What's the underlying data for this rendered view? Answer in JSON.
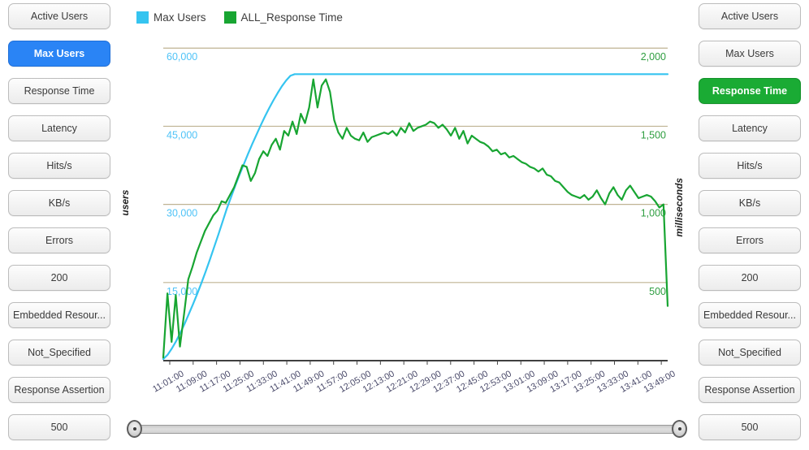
{
  "sidebar_left": {
    "selected": "Max Users",
    "items": [
      {
        "label": "Active Users",
        "state": "normal"
      },
      {
        "label": "Max Users",
        "state": "selected-blue"
      },
      {
        "label": "Response Time",
        "state": "normal"
      },
      {
        "label": "Latency",
        "state": "normal"
      },
      {
        "label": "Hits/s",
        "state": "normal"
      },
      {
        "label": "KB/s",
        "state": "normal"
      },
      {
        "label": "Errors",
        "state": "normal"
      },
      {
        "label": "200",
        "state": "normal"
      },
      {
        "label": "Embedded Resour...",
        "state": "normal"
      },
      {
        "label": "Not_Specified",
        "state": "normal"
      },
      {
        "label": "Response Assertion",
        "state": "normal"
      },
      {
        "label": "500",
        "state": "normal"
      }
    ]
  },
  "sidebar_right": {
    "selected": "Response Time",
    "items": [
      {
        "label": "Active Users",
        "state": "normal"
      },
      {
        "label": "Max Users",
        "state": "normal"
      },
      {
        "label": "Response Time",
        "state": "selected-green"
      },
      {
        "label": "Latency",
        "state": "normal"
      },
      {
        "label": "Hits/s",
        "state": "normal"
      },
      {
        "label": "KB/s",
        "state": "normal"
      },
      {
        "label": "Errors",
        "state": "normal"
      },
      {
        "label": "200",
        "state": "normal"
      },
      {
        "label": "Embedded Resour...",
        "state": "normal"
      },
      {
        "label": "Not_Specified",
        "state": "normal"
      },
      {
        "label": "Response Assertion",
        "state": "normal"
      },
      {
        "label": "500",
        "state": "normal"
      }
    ]
  },
  "slider": {
    "left_handle_position_pct": 0,
    "right_handle_position_pct": 100
  },
  "colors": {
    "max_users": "#35c4f0",
    "response_time": "#18a532",
    "gridline": "#bfb393",
    "axis": "#000000",
    "left_axis_text": "#4fc3f7",
    "right_axis_text": "#2f9e41",
    "xtick_text": "#4a4a6a",
    "selected_blue": "#2a84f5",
    "selected_green": "#1aab34"
  },
  "chart_data": {
    "type": "line",
    "title": "",
    "xlabel": "",
    "legend": [
      {
        "name": "Max Users",
        "color": "#35c4f0",
        "axis": "left"
      },
      {
        "name": "ALL_Response Time",
        "color": "#18a532",
        "axis": "right"
      }
    ],
    "legend_position": "top-left",
    "grid": true,
    "left_axis": {
      "ylabel": "users",
      "ticks": [
        "60,000",
        "45,000",
        "30,000",
        "15,000"
      ],
      "tick_values": [
        60000,
        45000,
        30000,
        15000
      ],
      "ylim": [
        0,
        63000
      ],
      "color": "#4fc3f7"
    },
    "right_axis": {
      "ylabel": "milliseconds",
      "ticks": [
        "2,000",
        "1,500",
        "1,000",
        "500"
      ],
      "tick_values": [
        2000,
        1500,
        1000,
        500
      ],
      "ylim": [
        0,
        2100
      ],
      "color": "#2f9e41"
    },
    "x_ticks": [
      "11:01:00",
      "11:09:00",
      "11:17:00",
      "11:25:00",
      "11:33:00",
      "11:41:00",
      "11:49:00",
      "11:57:00",
      "12:05:00",
      "12:13:00",
      "12:21:00",
      "12:29:00",
      "12:37:00",
      "12:45:00",
      "12:53:00",
      "13:01:00",
      "13:09:00",
      "13:17:00",
      "13:25:00",
      "13:33:00",
      "13:41:00",
      "13:49:00"
    ],
    "x_range": [
      "11:01:00",
      "13:53:00"
    ],
    "series": [
      {
        "name": "Max Users",
        "color": "#35c4f0",
        "axis": "left",
        "unit": "users",
        "values": [
          300,
          1100,
          2300,
          3700,
          5300,
          7000,
          8900,
          10800,
          12800,
          14900,
          17100,
          19400,
          21800,
          24200,
          26700,
          29200,
          31400,
          33600,
          35700,
          37700,
          39700,
          41600,
          43400,
          45200,
          46900,
          48500,
          50000,
          51400,
          52700,
          53800,
          54700,
          55000,
          55000,
          55000,
          55000,
          55000,
          55000,
          55000,
          55000,
          55000,
          55000,
          55000,
          55000,
          55000,
          55000,
          55000,
          55000,
          55000,
          55000,
          55000,
          55000,
          55000,
          55000,
          55000,
          55000,
          55000,
          55000,
          55000,
          55000,
          55000,
          55000,
          55000,
          55000,
          55000,
          55000,
          55000,
          55000,
          55000,
          55000,
          55000,
          55000,
          55000,
          55000,
          55000,
          55000,
          55000,
          55000,
          55000,
          55000,
          55000,
          55000,
          55000,
          55000,
          55000,
          55000,
          55000,
          55000,
          55000,
          55000,
          55000,
          55000,
          55000,
          55000,
          55000,
          55000,
          55000,
          55000,
          55000,
          55000,
          55000,
          55000,
          55000,
          55000,
          55000,
          55000,
          55000,
          55000,
          55000,
          55000,
          55000,
          55000,
          55000,
          55000,
          55000,
          55000,
          55000,
          55000,
          55000,
          55000,
          55000
        ]
      },
      {
        "name": "ALL_Response Time",
        "color": "#18a532",
        "axis": "right",
        "unit": "milliseconds",
        "values": [
          20,
          430,
          120,
          420,
          90,
          300,
          520,
          600,
          690,
          760,
          830,
          880,
          930,
          960,
          1020,
          1010,
          1060,
          1110,
          1180,
          1250,
          1240,
          1150,
          1200,
          1290,
          1340,
          1310,
          1380,
          1420,
          1350,
          1470,
          1440,
          1530,
          1450,
          1580,
          1520,
          1620,
          1800,
          1620,
          1760,
          1800,
          1720,
          1540,
          1460,
          1420,
          1490,
          1440,
          1420,
          1410,
          1460,
          1400,
          1430,
          1440,
          1450,
          1460,
          1450,
          1470,
          1440,
          1490,
          1460,
          1520,
          1470,
          1490,
          1500,
          1510,
          1530,
          1520,
          1490,
          1510,
          1480,
          1440,
          1490,
          1420,
          1470,
          1390,
          1440,
          1420,
          1400,
          1390,
          1370,
          1340,
          1350,
          1320,
          1330,
          1300,
          1310,
          1290,
          1270,
          1260,
          1240,
          1230,
          1210,
          1230,
          1190,
          1180,
          1150,
          1140,
          1110,
          1080,
          1060,
          1050,
          1040,
          1060,
          1030,
          1050,
          1090,
          1040,
          1000,
          1070,
          1110,
          1060,
          1030,
          1090,
          1120,
          1080,
          1040,
          1050,
          1060,
          1050,
          1020,
          980,
          1000,
          350
        ]
      }
    ]
  }
}
